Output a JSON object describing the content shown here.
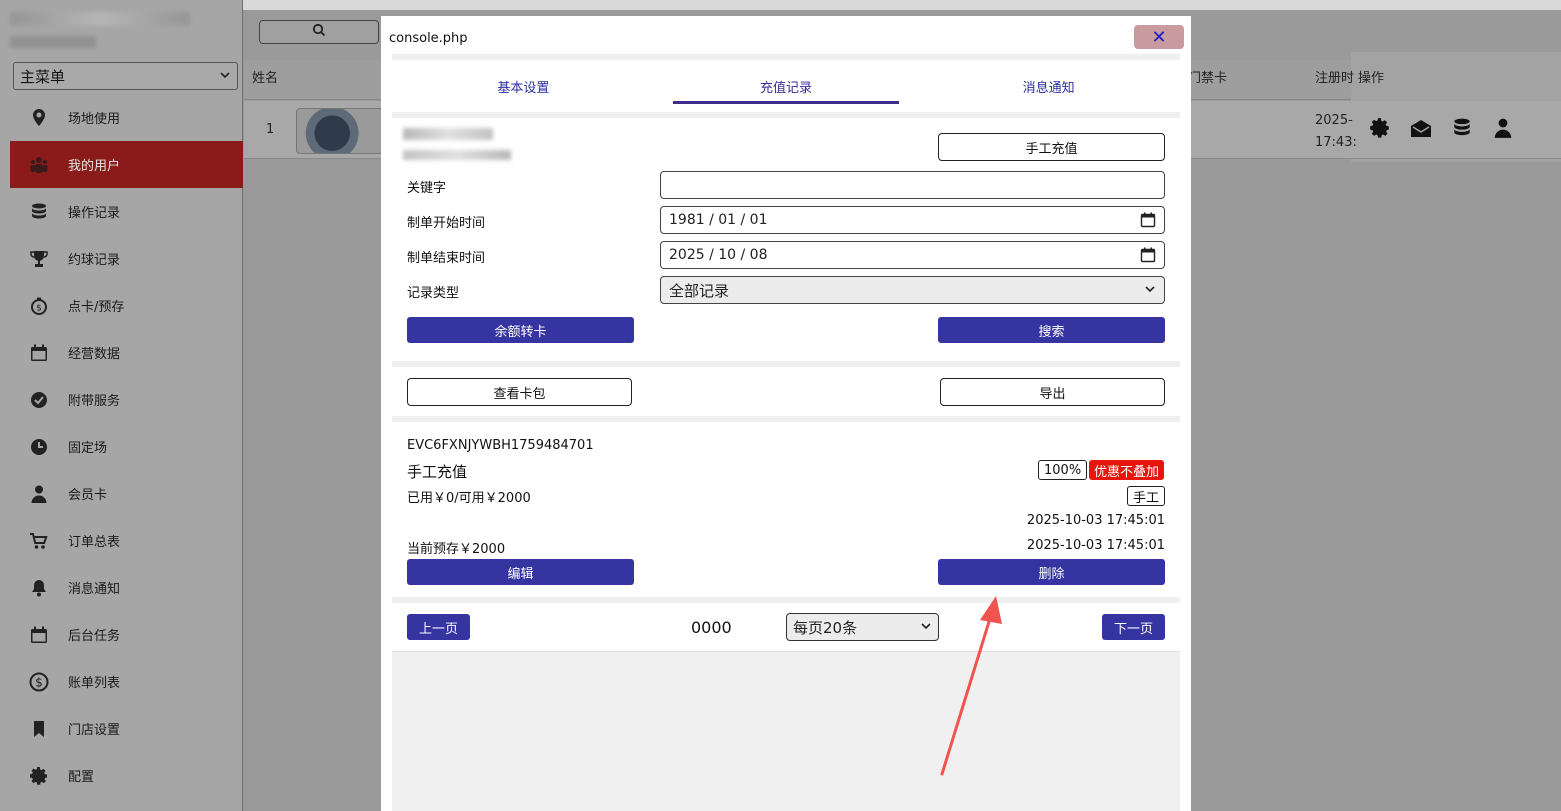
{
  "sidebar": {
    "menu_select": "主菜单",
    "items": [
      {
        "label": "场地使用",
        "icon": "map-pin-icon"
      },
      {
        "label": "我的用户",
        "icon": "users-icon",
        "active": true
      },
      {
        "label": "操作记录",
        "icon": "database-icon"
      },
      {
        "label": "约球记录",
        "icon": "trophy-icon"
      },
      {
        "label": "点卡/预存",
        "icon": "piggy-bank-icon"
      },
      {
        "label": "经营数据",
        "icon": "calendar-icon"
      },
      {
        "label": "附带服务",
        "icon": "check-circle-icon"
      },
      {
        "label": "固定场",
        "icon": "clock-icon"
      },
      {
        "label": "会员卡",
        "icon": "user-icon"
      },
      {
        "label": "订单总表",
        "icon": "cart-icon"
      },
      {
        "label": "消息通知",
        "icon": "bell-icon"
      },
      {
        "label": "后台任务",
        "icon": "calendar-icon"
      },
      {
        "label": "账单列表",
        "icon": "dollar-icon"
      },
      {
        "label": "门店设置",
        "icon": "bookmark-icon"
      },
      {
        "label": "配置",
        "icon": "gear-icon"
      }
    ]
  },
  "table": {
    "col_name": "姓名",
    "col_door": "门禁卡",
    "col_reg": "注册时",
    "col_ops": "操作",
    "row_num": "1",
    "reg_date_1": "2025-",
    "reg_date_2": "17:43:"
  },
  "modal": {
    "title": "console.php",
    "close": "✕",
    "tabs": [
      "基本设置",
      "充值记录",
      "消息通知"
    ],
    "manual_topup": "手工充值",
    "keyword_label": "关键字",
    "keyword_value": "",
    "start_label": "制单开始时间",
    "start_value": "1981 / 01 / 01",
    "end_label": "制单结束时间",
    "end_value": "2025 / 10 / 08",
    "type_label": "记录类型",
    "type_value": "全部记录",
    "balance_transfer": "余额转卡",
    "search": "搜索",
    "view_wallet": "查看卡包",
    "export": "导出",
    "record": {
      "id": "EVC6FXNJYWBH1759484701",
      "type": "手工充值",
      "used": "已用￥0/可用￥2000",
      "pct_badge": "100%",
      "promo_badge": "优惠不叠加",
      "manual_badge": "手工",
      "time1": "2025-10-03 17:45:01",
      "deposit": "当前预存￥2000",
      "time2": "2025-10-03 17:45:01",
      "edit": "编辑",
      "delete": "删除"
    },
    "pager": {
      "prev": "上一页",
      "number": "0000",
      "per_page": "每页20条",
      "next": "下一页"
    }
  },
  "colors": {
    "primary_button": "#3634a0",
    "tab_active": "#3f2a8e",
    "promo_badge": "#e8150f",
    "sidebar_active": "#8b1a1a",
    "annotation_arrow": "#f0544f"
  }
}
